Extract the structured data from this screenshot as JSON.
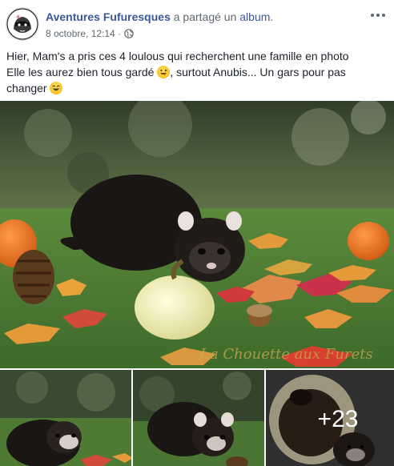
{
  "post": {
    "author": "Aventures Fufuresques",
    "action": " a partagé un ",
    "object": "album",
    "action_end": ".",
    "date": "8 octobre, 12:14 · ",
    "caption": {
      "line1": "Hier, Mam's a pris ces 4 loulous qui recherchent une famille en photo",
      "line2a": "Elle les aurez bien tous gardé ",
      "line2b": ", surtout Anubis... Un gars pour pas",
      "line3": "changer "
    },
    "watermark": "La Chouette aux Furets",
    "more_photos": "+23"
  },
  "icons": {
    "privacy": "globe-icon",
    "menu": "more-options-icon"
  },
  "colors": {
    "author": "#385898",
    "muted": "#616770",
    "overlay_text": "#ffffff"
  }
}
